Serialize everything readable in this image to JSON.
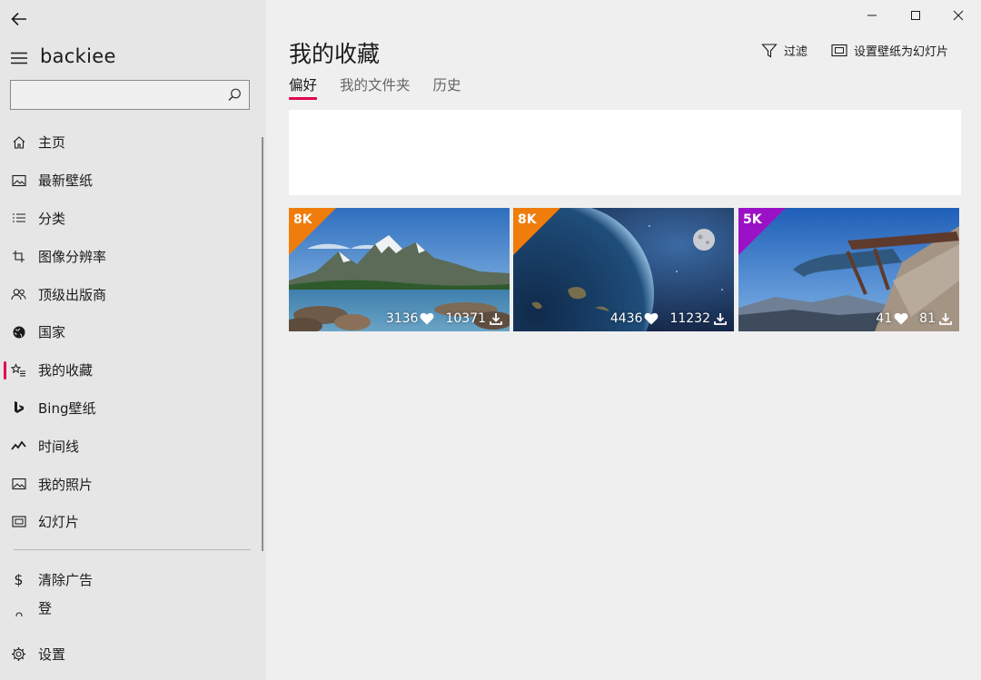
{
  "app": {
    "brand": "backiee"
  },
  "search": {
    "placeholder": "",
    "value": ""
  },
  "sidebar": {
    "items": [
      {
        "label": "主页",
        "icon": "home-icon"
      },
      {
        "label": "最新壁纸",
        "icon": "image-icon"
      },
      {
        "label": "分类",
        "icon": "list-icon"
      },
      {
        "label": "图像分辨率",
        "icon": "crop-icon"
      },
      {
        "label": "顶级出版商",
        "icon": "people-icon"
      },
      {
        "label": "国家",
        "icon": "globe-icon"
      },
      {
        "label": "我的收藏",
        "icon": "star-list-icon"
      },
      {
        "label": "Bing壁纸",
        "icon": "bing-icon"
      },
      {
        "label": "时间线",
        "icon": "trend-icon"
      },
      {
        "label": "我的照片",
        "icon": "photo-icon"
      },
      {
        "label": "幻灯片",
        "icon": "slideshow-icon"
      }
    ],
    "active_index": 6,
    "remove_ads": "清除广告",
    "partial_item": "登录",
    "settings": "设置"
  },
  "main": {
    "title": "我的收藏",
    "tabs": [
      {
        "label": "偏好"
      },
      {
        "label": "我的文件夹"
      },
      {
        "label": "历史"
      }
    ],
    "active_tab": 0,
    "toolbar": {
      "filter": "过滤",
      "slideshow": "设置壁纸为幻灯片"
    }
  },
  "wallpapers": [
    {
      "badge": "8K",
      "badge_color": "#f07c0b",
      "likes": "3136",
      "downloads": "10371",
      "subject": "mountain-lake"
    },
    {
      "badge": "8K",
      "badge_color": "#f07c0b",
      "likes": "4436",
      "downloads": "11232",
      "subject": "earth-from-space"
    },
    {
      "badge": "5K",
      "badge_color": "#9b12c6",
      "likes": "41",
      "downloads": "81",
      "subject": "glass-skywalk"
    }
  ],
  "colors": {
    "accent": "#e2004e",
    "sidebar_bg": "#e6e6e6",
    "content_bg": "#efefef"
  }
}
